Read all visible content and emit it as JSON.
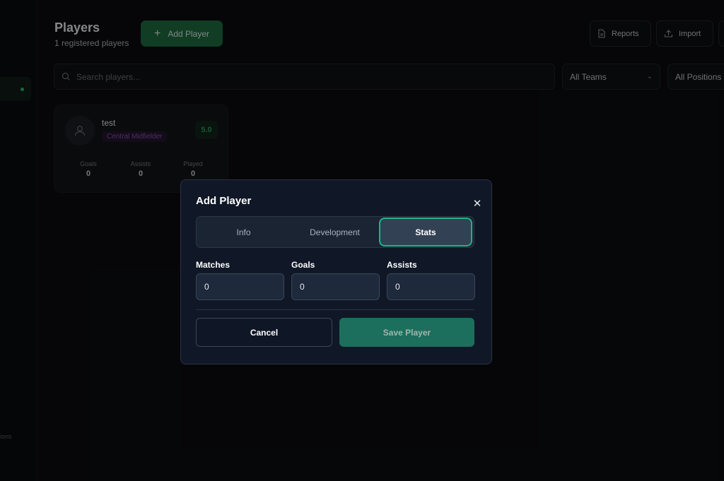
{
  "sidebar": {
    "footer_text": "ions"
  },
  "header": {
    "title": "Players",
    "subtitle": "1 registered players",
    "add_button": "Add Player",
    "reports_button": "Reports",
    "import_button": "Import"
  },
  "filters": {
    "search_placeholder": "Search players...",
    "team_select": "All Teams",
    "position_select": "All Positions"
  },
  "players": [
    {
      "name": "test",
      "position": "Central Midfielder",
      "rating": "5.0",
      "stats": [
        {
          "label": "Goals",
          "value": "0"
        },
        {
          "label": "Assists",
          "value": "0"
        },
        {
          "label": "Played",
          "value": "0"
        }
      ]
    }
  ],
  "modal": {
    "title": "Add Player",
    "tabs": [
      {
        "label": "Info"
      },
      {
        "label": "Development"
      },
      {
        "label": "Stats"
      }
    ],
    "active_tab": "Stats",
    "fields": [
      {
        "label": "Matches",
        "value": "0"
      },
      {
        "label": "Goals",
        "value": "0"
      },
      {
        "label": "Assists",
        "value": "0"
      }
    ],
    "cancel_label": "Cancel",
    "save_label": "Save Player"
  },
  "colors": {
    "accent": "#1fb486",
    "save_button": "#1c6f5c",
    "modal_bg": "#101827"
  }
}
